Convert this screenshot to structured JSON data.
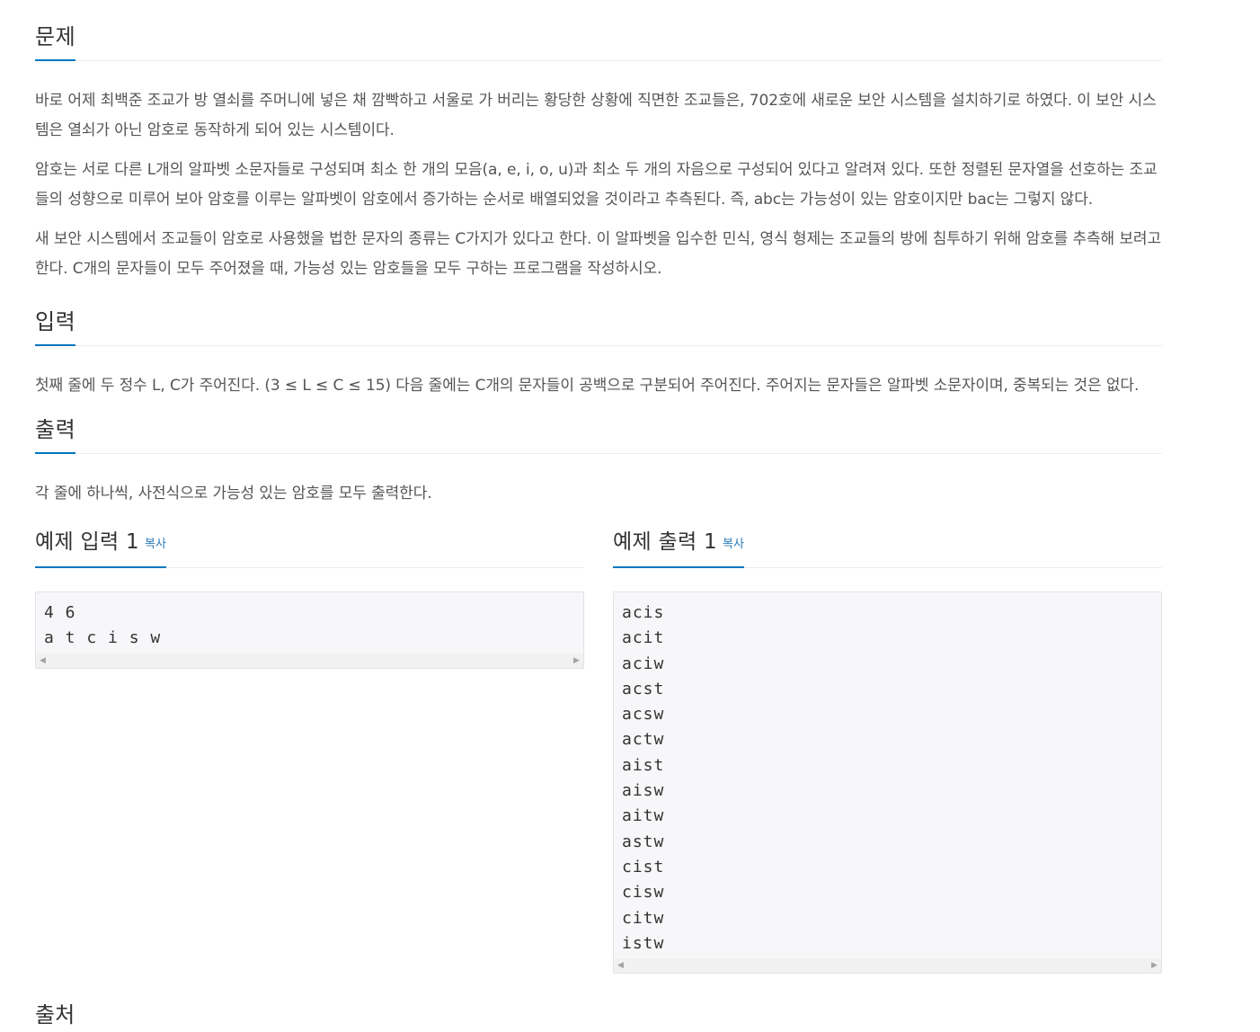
{
  "sections": {
    "problem": {
      "title": "문제",
      "paragraphs": [
        "바로 어제 최백준 조교가 방 열쇠를 주머니에 넣은 채 깜빡하고 서울로 가 버리는 황당한 상황에 직면한 조교들은, 702호에 새로운 보안 시스템을 설치하기로 하였다. 이 보안 시스템은 열쇠가 아닌 암호로 동작하게 되어 있는 시스템이다.",
        "암호는 서로 다른 L개의 알파벳 소문자들로 구성되며 최소 한 개의 모음(a, e, i, o, u)과 최소 두 개의 자음으로 구성되어 있다고 알려져 있다. 또한 정렬된 문자열을 선호하는 조교들의 성향으로 미루어 보아 암호를 이루는 알파벳이 암호에서 증가하는 순서로 배열되었을 것이라고 추측된다. 즉, abc는 가능성이 있는 암호이지만 bac는 그렇지 않다.",
        "새 보안 시스템에서 조교들이 암호로 사용했을 법한 문자의 종류는 C가지가 있다고 한다. 이 알파벳을 입수한 민식, 영식 형제는 조교들의 방에 침투하기 위해 암호를 추측해 보려고 한다. C개의 문자들이 모두 주어졌을 때, 가능성 있는 암호들을 모두 구하는 프로그램을 작성하시오."
      ]
    },
    "input": {
      "title": "입력",
      "text": "첫째 줄에 두 정수 L, C가 주어진다. (3 ≤ L ≤ C ≤ 15) 다음 줄에는 C개의 문자들이 공백으로 구분되어 주어진다. 주어지는 문자들은 알파벳 소문자이며, 중복되는 것은 없다."
    },
    "output": {
      "title": "출력",
      "text": "각 줄에 하나씩, 사전식으로 가능성 있는 암호를 모두 출력한다."
    },
    "source": {
      "title": "출처"
    }
  },
  "samples": {
    "input": {
      "title": "예제 입력 1",
      "copy_label": "복사",
      "content": "4 6\na t c i s w"
    },
    "output": {
      "title": "예제 출력 1",
      "copy_label": "복사",
      "content": "acis\nacit\naciw\nacst\nacsw\nactw\naist\naisw\naitw\nastw\ncist\ncisw\ncitw\nistw"
    }
  },
  "icons": {
    "scroll_left": "caret-left-icon",
    "scroll_right": "caret-right-icon"
  },
  "colors": {
    "accent": "#0076c0",
    "link": "#2a7ab8",
    "text": "#555555",
    "pre_bg": "#f7f7f9"
  }
}
